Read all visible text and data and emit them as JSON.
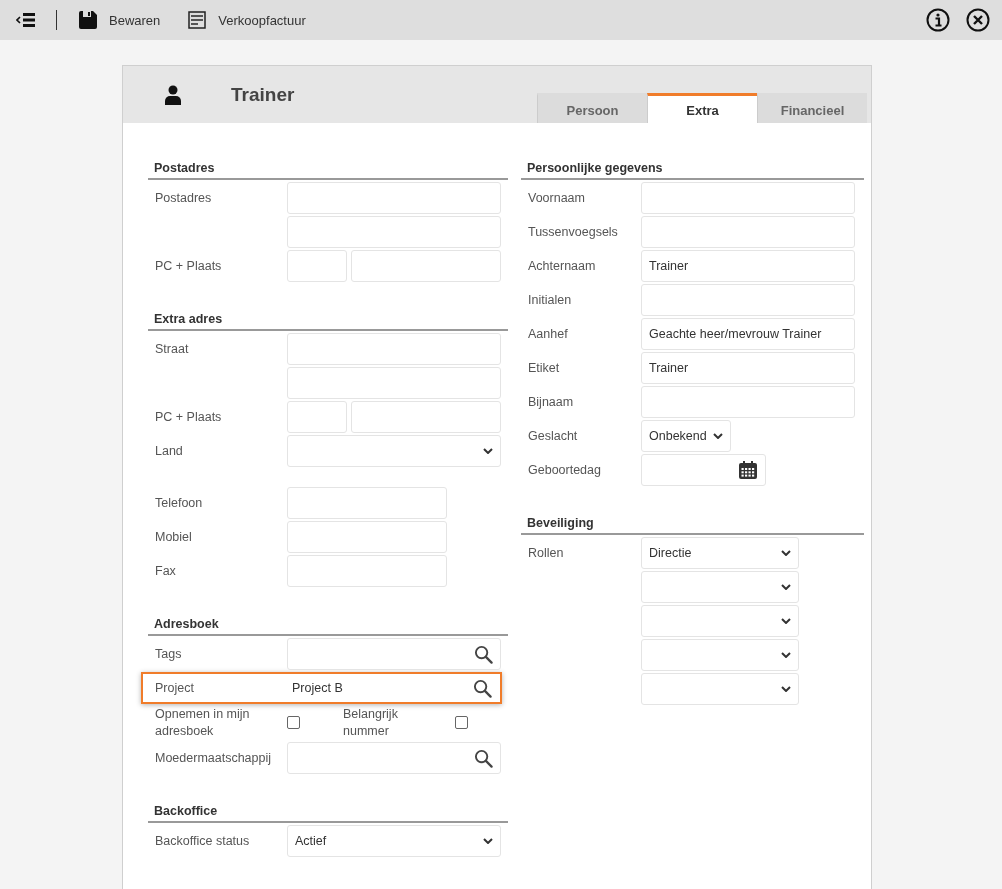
{
  "toolbar": {
    "buttons": [
      {
        "kind": "save",
        "label": "Bewaren"
      },
      {
        "kind": "invoice",
        "label": "Verkoopfactuur"
      }
    ]
  },
  "card": {
    "title": "Trainer",
    "tabs": [
      {
        "label": "Persoon",
        "selected": false
      },
      {
        "label": "Extra",
        "selected": true
      },
      {
        "label": "Financieel",
        "selected": false
      }
    ],
    "columns": [
      {
        "sections": [
          {
            "title": "Postadres",
            "rows": [
              {
                "label": "Postadres",
                "kind": "text"
              },
              {
                "kind": "text"
              },
              {
                "label": "PC + Plaats",
                "kind": "postcode"
              }
            ]
          },
          {
            "title": "Extra adres",
            "rows": [
              {
                "label": "Straat",
                "kind": "text"
              },
              {
                "kind": "text"
              },
              {
                "label": "PC + Plaats",
                "kind": "postcode"
              },
              {
                "label": "Land",
                "kind": "select"
              },
              {
                "label": "Telefoon",
                "kind": "phone"
              },
              {
                "label": "Mobiel",
                "kind": "phone"
              },
              {
                "label": "Fax",
                "kind": "phone"
              }
            ]
          },
          {
            "title": "Adresboek",
            "rows": [
              {
                "label": "Tags",
                "kind": "search",
                "highlighted": false
              },
              {
                "label": "Project",
                "kind": "search",
                "value": "Project B",
                "highlighted": true
              },
              {
                "kind": "checks",
                "checks": [
                  {
                    "label": "Opnemen in mijn adresboek",
                    "checked": false
                  },
                  {
                    "label": "Belangrijk nummer",
                    "checked": false
                  }
                ]
              },
              {
                "label": "Moedermaatschappij",
                "kind": "search",
                "highlighted": false
              }
            ]
          },
          {
            "title": "Backoffice",
            "rows": [
              {
                "label": "Backoffice status",
                "kind": "select",
                "value": "Actief"
              }
            ]
          }
        ]
      },
      {
        "sections": [
          {
            "title": "Persoonlijke gegevens",
            "rows": [
              {
                "label": "Voornaam",
                "kind": "text"
              },
              {
                "label": "Tussenvoegsels",
                "kind": "text"
              },
              {
                "label": "Achternaam",
                "kind": "text",
                "value": "Trainer"
              },
              {
                "label": "Initialen",
                "kind": "text"
              },
              {
                "label": "Aanhef",
                "kind": "text",
                "value": "Geachte heer/mevrouw Trainer"
              },
              {
                "label": "Etiket",
                "kind": "text",
                "value": "Trainer"
              },
              {
                "label": "Bijnaam",
                "kind": "text"
              },
              {
                "label": "Geslacht",
                "kind": "gender",
                "value": "Onbekend"
              },
              {
                "label": "Geboortedag",
                "kind": "date"
              }
            ]
          },
          {
            "title": "Beveiliging",
            "rows": [
              {
                "label": "Rollen",
                "kind": "roles",
                "selects": [
                  {
                    "kind": "filled",
                    "value": "Directie"
                  },
                  {
                    "kind": "empty"
                  },
                  {
                    "kind": "empty"
                  },
                  {
                    "kind": "empty"
                  },
                  {
                    "kind": "empty"
                  }
                ]
              }
            ]
          }
        ]
      }
    ]
  }
}
